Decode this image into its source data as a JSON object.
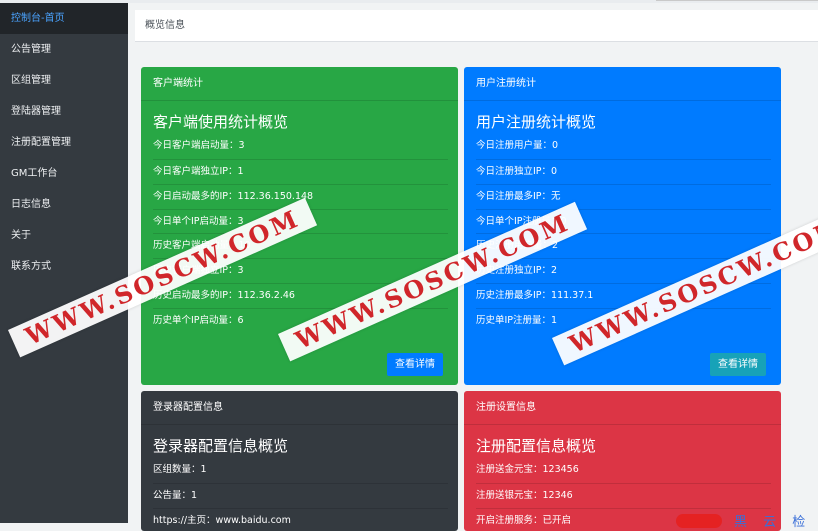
{
  "sidebar": {
    "items": [
      {
        "label": "控制台-首页",
        "active": true
      },
      {
        "label": "公告管理"
      },
      {
        "label": "区组管理"
      },
      {
        "label": "登陆器管理"
      },
      {
        "label": "注册配置管理"
      },
      {
        "label": "GM工作台"
      },
      {
        "label": "日志信息"
      },
      {
        "label": "关于"
      },
      {
        "label": "联系方式"
      }
    ]
  },
  "breadcrumb": "概览信息",
  "cards": {
    "client": {
      "header": "客户端统计",
      "title": "客户端使用统计概览",
      "rows": [
        "今日客户端启动量：3",
        "今日客户端独立IP：1",
        "今日启动最多的IP：112.36.150.148",
        "今日单个IP启动量：3",
        "历史客户端启动量：10",
        "历史客户端独立IP：3",
        "历史启动最多的IP：112.36.2.46",
        "历史单个IP启动量：6"
      ],
      "button": "查看详情"
    },
    "register": {
      "header": "用户注册统计",
      "title": "用户注册统计概览",
      "rows": [
        "今日注册用户量：0",
        "今日注册独立IP：0",
        "今日注册最多IP：无",
        "今日单个IP注册量：0",
        "历史注册用户量：2",
        "历史注册独立IP：2",
        "历史注册最多IP：111.37.1",
        "历史单IP注册量：1"
      ],
      "button": "查看详情"
    },
    "launcher": {
      "header": "登录器配置信息",
      "title": "登录器配置信息概览",
      "rows": [
        "区组数量：1",
        "公告量：1",
        "https://主页：www.baidu.com"
      ]
    },
    "regconfig": {
      "header": "注册设置信息",
      "title": "注册配置信息概览",
      "rows": [
        "注册送金元宝：123456",
        "注册送银元宝：12346",
        "开启注册服务：已开启"
      ]
    }
  },
  "watermark": "WWW.SOSCW.COM",
  "corner_text": "黑 云 检",
  "colors": {
    "green": "#28a745",
    "blue": "#007bff",
    "dark": "#343a40",
    "red": "#dc3545",
    "sidebar": "#343a40",
    "watermark_text": "#d0262a"
  }
}
